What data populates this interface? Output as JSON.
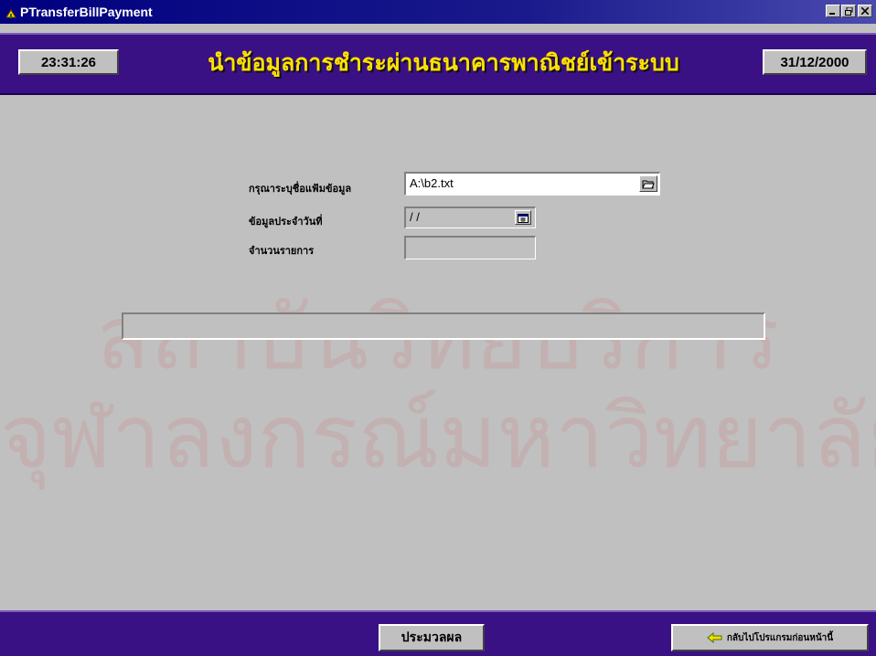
{
  "window": {
    "title": "PTransferBillPayment",
    "controls": {
      "minimize": "_",
      "maximize": "▫",
      "close": "×"
    }
  },
  "header": {
    "time": "23:31:26",
    "title": "นำข้อมูลการชำระผ่านธนาคารพาณิชย์เข้าระบบ",
    "date": "31/12/2000"
  },
  "form": {
    "filename_label": "กรุณาระบุชื่อแฟ้มข้อมูล",
    "filename_value": "A:\\b2.txt",
    "data_date_label": "ข้อมูลประจำวันที่",
    "data_date_value": "/ /",
    "record_count_label": "จำนวนรายการ",
    "record_count_value": ""
  },
  "progress": {
    "value": 0
  },
  "footer": {
    "process_button": "ประมวลผล",
    "back_button": "กลับไปโปรแกรมก่อนหน้านี้"
  },
  "watermark": {
    "line1": "สถาบันวิทยบริการ",
    "line2": "จุฬาลงกรณ์มหาวิทยาลัย"
  },
  "colors": {
    "band": "#3a1085",
    "title_text": "#ffe100",
    "titlebar": "#000080"
  },
  "icons": {
    "app": "app-icon",
    "browse": "open-folder-icon",
    "calendar": "calendar-icon",
    "back": "back-arrow-icon"
  }
}
